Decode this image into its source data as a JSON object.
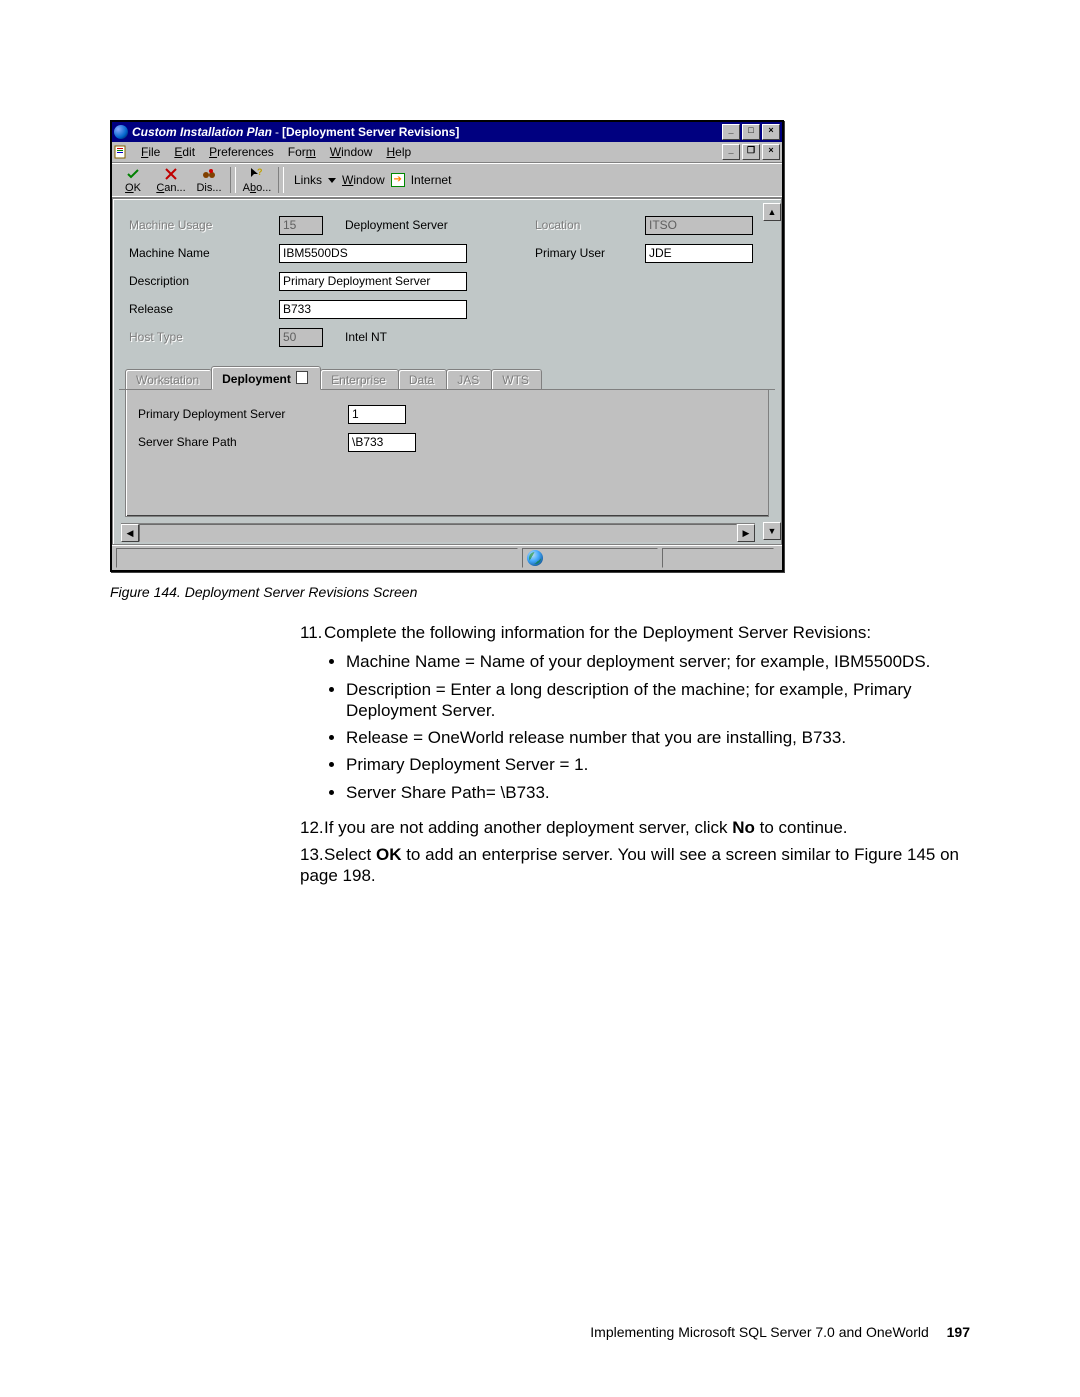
{
  "window": {
    "title_italic": "Custom Installation Plan",
    "title_sep": " - ",
    "title_sub": "[Deployment Server Revisions]",
    "sys_buttons": {
      "min": "_",
      "max": "□",
      "close": "×"
    },
    "mdi_buttons": {
      "min": "_",
      "restore": "❐",
      "close": "×"
    }
  },
  "menubar": {
    "items": [
      "File",
      "Edit",
      "Preferences",
      "Form",
      "Window",
      "Help"
    ]
  },
  "toolbar": {
    "ok": "OK",
    "can": "Can...",
    "dis": "Dis...",
    "abo": "Abo...",
    "links": "Links",
    "window": "Window",
    "internet": "Internet"
  },
  "form": {
    "machine_usage_label": "Machine Usage",
    "machine_usage_value": "15",
    "machine_usage_after": "Deployment Server",
    "location_label": "Location",
    "location_value": "ITSO",
    "machine_name_label": "Machine Name",
    "machine_name_value": "IBM5500DS",
    "primary_user_label": "Primary User",
    "primary_user_value": "JDE",
    "description_label": "Description",
    "description_value": "Primary Deployment Server",
    "release_label": "Release",
    "release_value": "B733",
    "host_type_label": "Host Type",
    "host_type_value": "50",
    "host_type_after": "Intel NT"
  },
  "tabs": {
    "workstation": "Workstation",
    "deployment": "Deployment",
    "enterprise": "Enterprise",
    "data": "Data",
    "jas": "JAS",
    "wts": "WTS"
  },
  "tabpane": {
    "primary_label": "Primary Deployment Server",
    "primary_value": "1",
    "share_label": "Server Share Path",
    "share_value": "\\B733"
  },
  "figure": {
    "caption": "Figure 144. Deployment Server Revisions Screen"
  },
  "text": {
    "step11": "Complete the following information for the Deployment Server Revisions:",
    "b1": "Machine Name = Name of your deployment server; for example, IBM5500DS.",
    "b2": "Description = Enter a long description of the machine; for example, Primary Deployment Server.",
    "b3": "Release = OneWorld release number that you are installing, B733.",
    "b4": "Primary Deployment Server = 1.",
    "b5": "Server Share Path= \\B733.",
    "step12_a": "If you are not adding another deployment server, click ",
    "step12_bold": "No",
    "step12_b": " to continue.",
    "step13_a": "Select ",
    "step13_bold": "OK",
    "step13_b": " to add an enterprise server. You will see a screen similar to Figure 145 on page 198."
  },
  "footer": {
    "book": "Implementing Microsoft SQL Server 7.0 and OneWorld",
    "page": "197"
  }
}
